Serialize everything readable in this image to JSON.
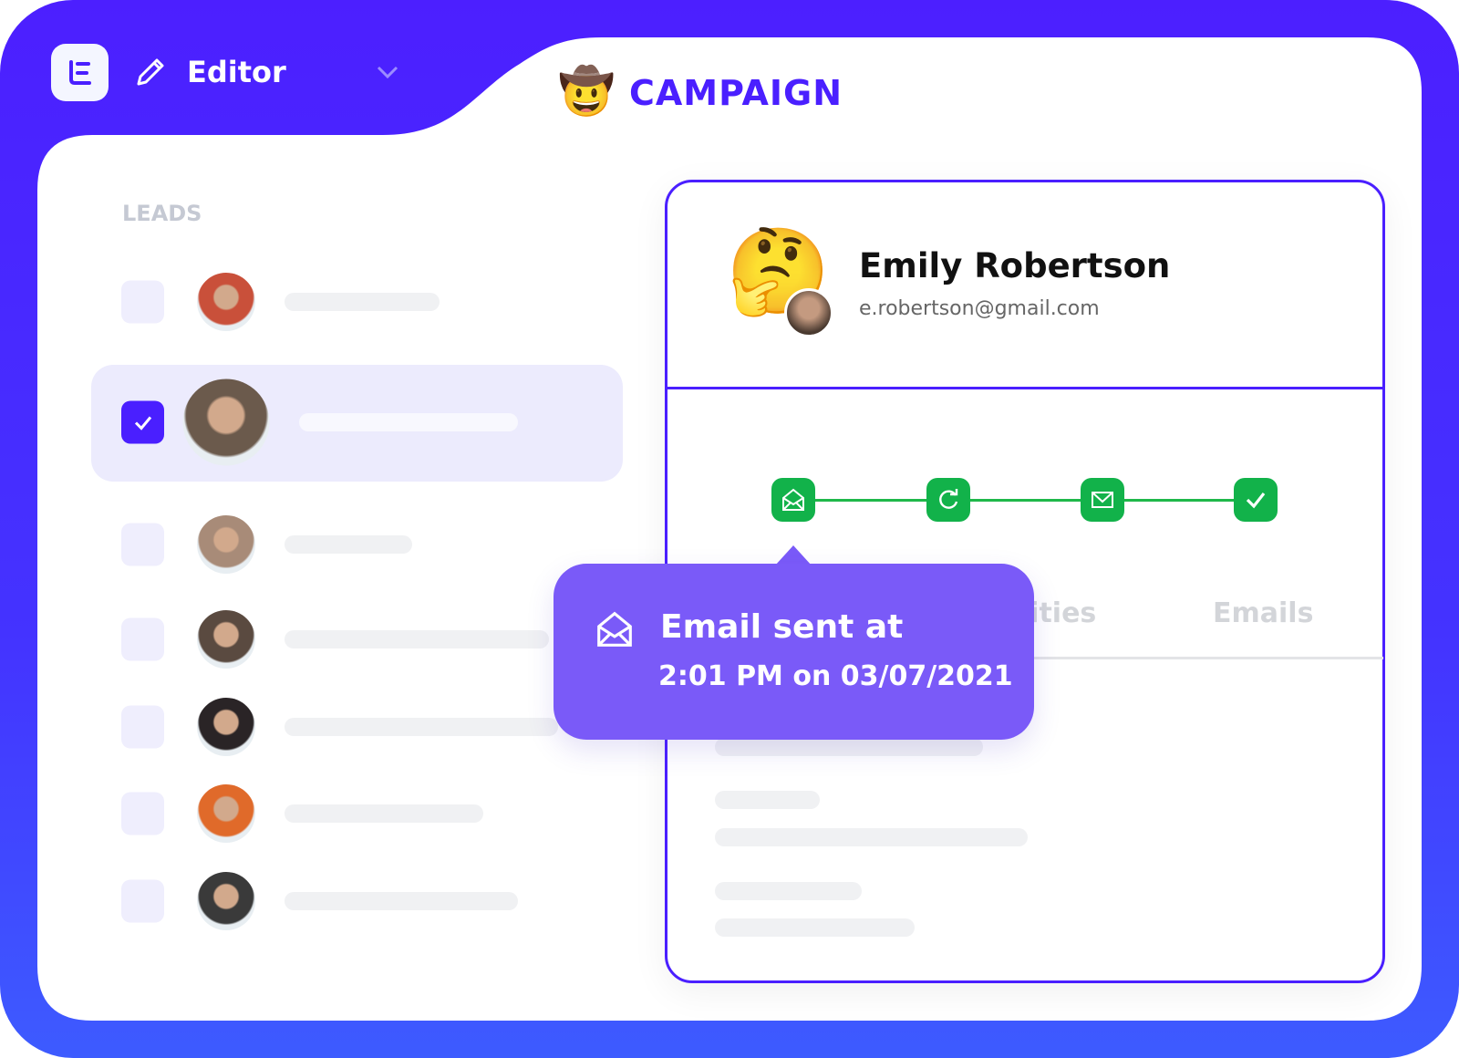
{
  "header": {
    "app_name": "Editor",
    "logo_icon": "logo-e-icon",
    "edit_icon": "pencil-icon",
    "dropdown_icon": "chevron-down-icon"
  },
  "campaign": {
    "emoji": "🤠",
    "title": "CAMPAIGN"
  },
  "leads": {
    "title": "LEADS",
    "items": [
      {
        "selected": false,
        "avatar_color": "#c9503a"
      },
      {
        "selected": true,
        "avatar_color": "#6b5a4c"
      },
      {
        "selected": false,
        "avatar_color": "#a88b78"
      },
      {
        "selected": false,
        "avatar_color": "#5a4a40"
      },
      {
        "selected": false,
        "avatar_color": "#2a2426"
      },
      {
        "selected": false,
        "avatar_color": "#e06a2a"
      },
      {
        "selected": false,
        "avatar_color": "#3a3a3a"
      }
    ]
  },
  "contact": {
    "emoji": "🤔",
    "name": "Emily Robertson",
    "email": "e.robertson@gmail.com"
  },
  "timeline": {
    "steps": [
      "email-open-icon",
      "refresh-icon",
      "mail-icon",
      "check-icon"
    ],
    "color": "#12b24a"
  },
  "tabs": [
    "Activities",
    "Emails"
  ],
  "tooltip": {
    "title": "Email sent at",
    "datetime": "2:01 PM on 03/07/2021",
    "icon": "email-open-icon"
  },
  "colors": {
    "brand": "#4a1fff",
    "tooltip": "#7a5af8",
    "success": "#12b24a"
  }
}
